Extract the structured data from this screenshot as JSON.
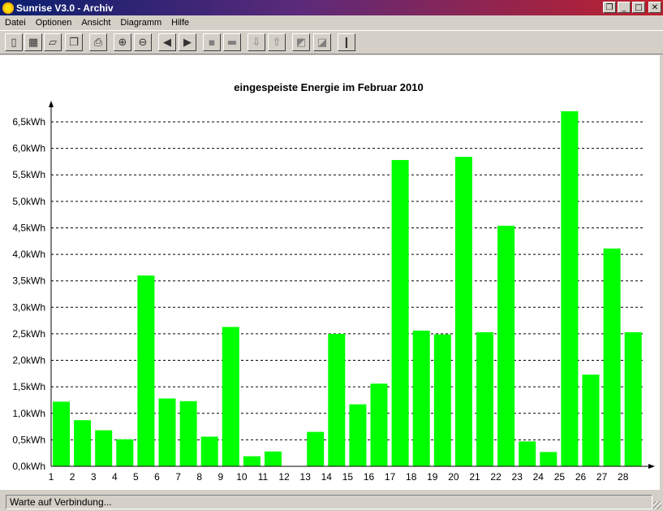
{
  "window": {
    "title": "Sunrise V3.0 - Archiv"
  },
  "menu": [
    "Datei",
    "Optionen",
    "Ansicht",
    "Diagramm",
    "Hilfe"
  ],
  "toolbar": [
    {
      "name": "battery-icon",
      "glyph": "▯"
    },
    {
      "name": "grid-chart-icon",
      "glyph": "▦"
    },
    {
      "name": "page-icon",
      "glyph": "▱"
    },
    {
      "name": "windows-icon",
      "glyph": "❐"
    },
    {
      "name": "printer-icon",
      "glyph": "⎙"
    },
    {
      "name": "zoom-in-icon",
      "glyph": "⊕"
    },
    {
      "name": "zoom-out-icon",
      "glyph": "⊖"
    },
    {
      "name": "arrow-left-icon",
      "glyph": "◀"
    },
    {
      "name": "arrow-right-icon",
      "glyph": "▶"
    },
    {
      "name": "sign-icon",
      "glyph": "▪"
    },
    {
      "name": "folder-icon",
      "glyph": "▬"
    },
    {
      "name": "plug-down-icon",
      "glyph": "⇩"
    },
    {
      "name": "plug-up-icon",
      "glyph": "⇧"
    },
    {
      "name": "solar-panel-icon",
      "glyph": "◩"
    },
    {
      "name": "solar-panel-down-icon",
      "glyph": "◪"
    },
    {
      "name": "thermometer-icon",
      "glyph": "❙"
    }
  ],
  "status": {
    "text": "Warte auf Verbindung..."
  },
  "colors": {
    "bar": "#00ff00",
    "titlebar_start": "#0a1f6e",
    "titlebar_end": "#c0202a"
  },
  "chart_data": {
    "type": "bar",
    "title": "eingespeiste Energie im Februar 2010",
    "categories": [
      "1",
      "2",
      "3",
      "4",
      "5",
      "6",
      "7",
      "8",
      "9",
      "10",
      "11",
      "12",
      "13",
      "14",
      "15",
      "16",
      "17",
      "18",
      "19",
      "20",
      "21",
      "22",
      "23",
      "24",
      "25",
      "26",
      "27",
      "28"
    ],
    "values": [
      1.22,
      0.87,
      0.68,
      0.51,
      3.6,
      1.28,
      1.23,
      0.56,
      2.63,
      0.19,
      0.28,
      0,
      0.65,
      2.5,
      1.17,
      1.56,
      5.78,
      2.56,
      2.49,
      5.84,
      2.53,
      4.54,
      0.47,
      0.27,
      6.7,
      1.73,
      4.11,
      2.53
    ],
    "y_ticks": [
      "0,0kWh",
      "0,5kWh",
      "1,0kWh",
      "1,5kWh",
      "2,0kWh",
      "2,5kWh",
      "3,0kWh",
      "3,5kWh",
      "4,0kWh",
      "4,5kWh",
      "5,0kWh",
      "5,5kWh",
      "6,0kWh",
      "6,5kWh"
    ],
    "ylim": [
      0,
      6.5
    ],
    "grid": true,
    "xlabel": "",
    "ylabel": ""
  }
}
